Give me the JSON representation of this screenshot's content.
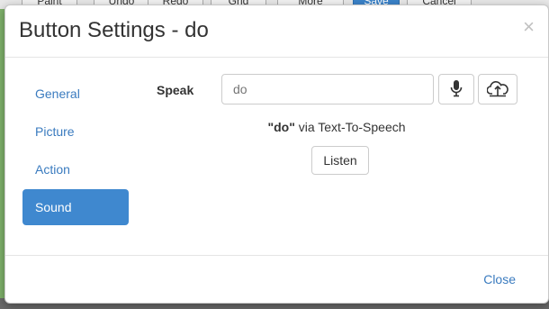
{
  "background_toolbar": {
    "buttons": [
      "Paint",
      "Undo",
      "Redo",
      "Grid",
      "More",
      "Save",
      "Cancel"
    ]
  },
  "modal": {
    "title": "Button Settings - do",
    "close_icon": "×",
    "nav": [
      {
        "label": "General",
        "active": false
      },
      {
        "label": "Picture",
        "active": false
      },
      {
        "label": "Action",
        "active": false
      },
      {
        "label": "Sound",
        "active": true
      }
    ],
    "speak_label": "Speak",
    "speak_input_value": "",
    "speak_input_placeholder": "do",
    "mic_icon": "microphone-icon",
    "upload_icon": "upload-icon",
    "tts_word": "\"do\"",
    "tts_suffix": " via Text-To-Speech",
    "listen_label": "Listen",
    "footer_close_label": "Close"
  },
  "colors": {
    "accent": "#3f88cf",
    "link": "#3a7bbf"
  }
}
